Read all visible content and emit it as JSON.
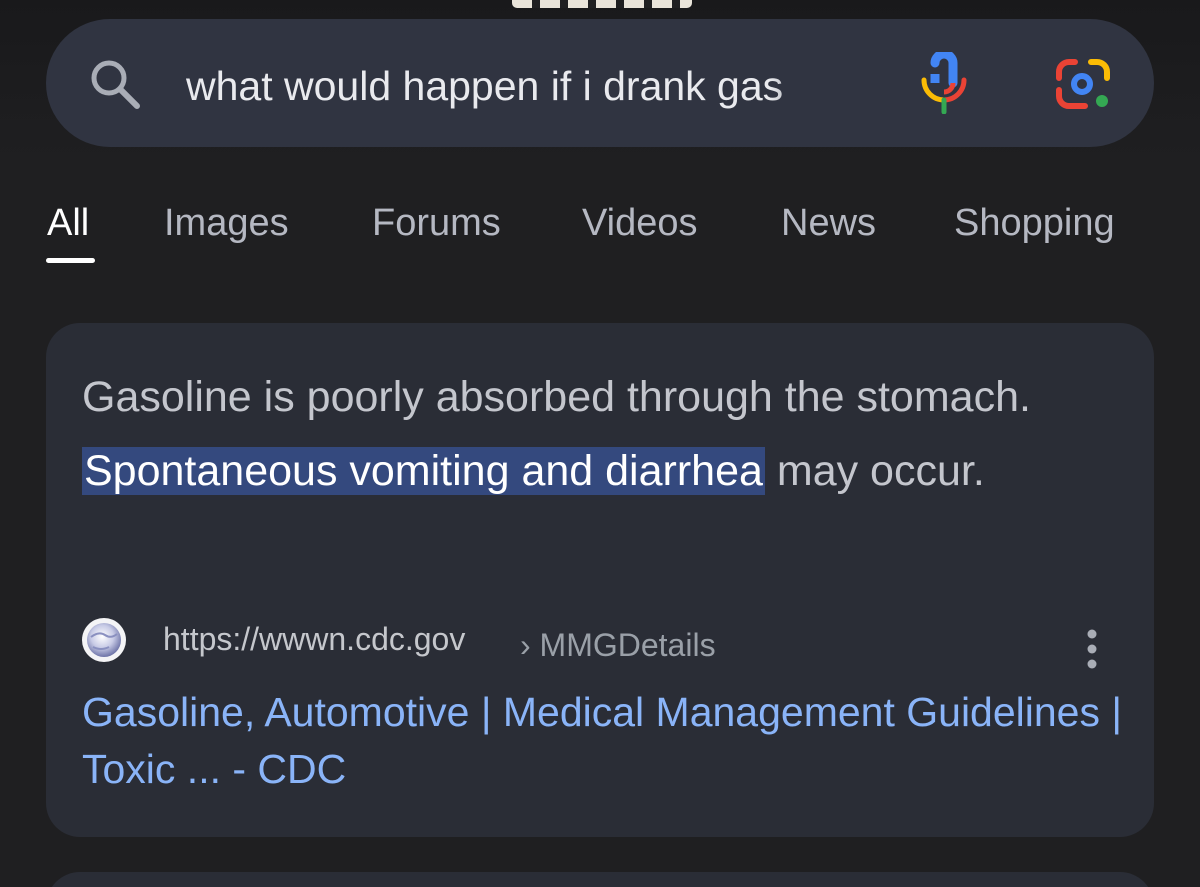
{
  "search": {
    "query": "what would happen if i drank gas",
    "icons": {
      "search": "search-icon",
      "voice": "microphone-icon",
      "lens": "google-lens-icon"
    }
  },
  "tabs": [
    {
      "label": "All",
      "active": true
    },
    {
      "label": "Images",
      "active": false
    },
    {
      "label": "Forums",
      "active": false
    },
    {
      "label": "Videos",
      "active": false
    },
    {
      "label": "News",
      "active": false
    },
    {
      "label": "Shopping",
      "active": false
    }
  ],
  "result": {
    "snippet_before": "Gasoline is poorly absorbed through the stomach. ",
    "snippet_highlight": "Spontaneous vomiting and diarrhea",
    "snippet_after": " may occur.",
    "source_url": "https://wwwn.cdc.gov",
    "source_path": "› MMGDetails",
    "title": "Gasoline, Automotive | Medical Management Guidelines | Toxic ... - CDC",
    "favicon": "globe-icon",
    "menu_icon": "more-vert-icon"
  },
  "colors": {
    "background": "#1f1f21",
    "search_bar": "#303441",
    "card": "#2a2d36",
    "link": "#8ab4f8",
    "highlight": "#34497e"
  }
}
